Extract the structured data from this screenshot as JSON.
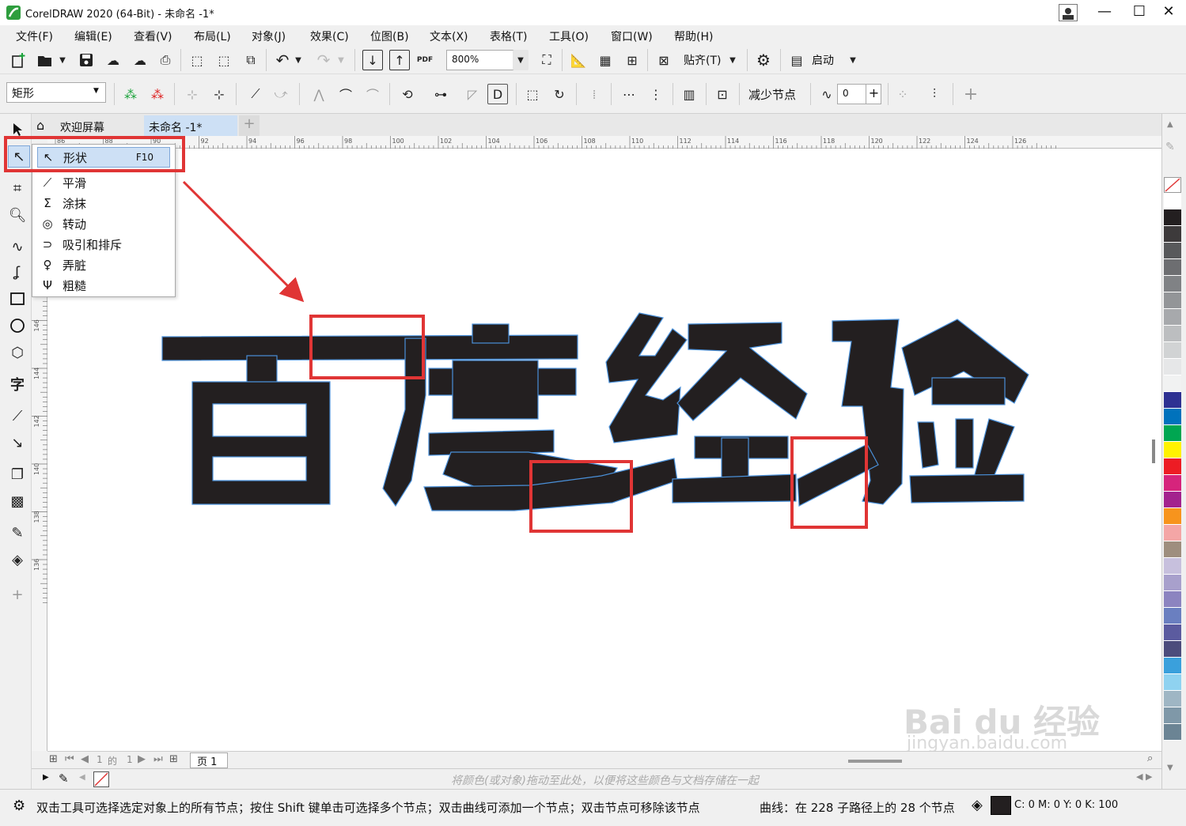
{
  "window": {
    "title": "CorelDRAW 2020 (64-Bit) - 未命名 -1*",
    "controls": {
      "minimize": "—",
      "maximize": "☐",
      "close": "✕"
    }
  },
  "menu": [
    "文件(F)",
    "编辑(E)",
    "查看(V)",
    "布局(L)",
    "对象(J)",
    "效果(C)",
    "位图(B)",
    "文本(X)",
    "表格(T)",
    "工具(O)",
    "窗口(W)",
    "帮助(H)"
  ],
  "toolbar": {
    "zoom": "800%",
    "snap_label": "贴齐(T)",
    "launch_label": "启动",
    "pdf_label": "PDF"
  },
  "propbar": {
    "shape_select": "矩形",
    "reduce_nodes": "减少节点",
    "smoothness_value": "0"
  },
  "tabs": {
    "welcome": "欢迎屏幕",
    "document": "未命名 -1*"
  },
  "ruler_h": [
    "86",
    "88",
    "90",
    "92",
    "94",
    "96",
    "98",
    "100",
    "102",
    "104",
    "106",
    "108",
    "110",
    "112",
    "114",
    "116",
    "118",
    "120",
    "122",
    "124",
    "126"
  ],
  "ruler_v": [
    "152",
    "150",
    "148",
    "146",
    "144",
    "142",
    "140",
    "138",
    "136"
  ],
  "flyout": {
    "items": [
      {
        "label": "形状",
        "shortcut": "F10",
        "icon": "shape-tool-icon"
      },
      {
        "label": "平滑",
        "icon": "smooth-icon"
      },
      {
        "label": "涂抹",
        "icon": "smear-icon"
      },
      {
        "label": "转动",
        "icon": "twirl-icon"
      },
      {
        "label": "吸引和排斥",
        "icon": "attract-repel-icon"
      },
      {
        "label": "弄脏",
        "icon": "smudge-icon"
      },
      {
        "label": "粗糙",
        "icon": "roughen-icon"
      }
    ]
  },
  "canvas_text": "百度经验",
  "pagebar": {
    "current": "1",
    "of": "的",
    "total": "1",
    "page_tab": "页 1"
  },
  "colorbar_hint": "将颜色(或对象)拖动至此处，以便将这些颜色与文档存储在一起",
  "status": {
    "hint": "双击工具可选择选定对象上的所有节点；按住 Shift 键单击可选择多个节点；双击曲线可添加一个节点；双击节点可移除该节点",
    "curve_info": "曲线：在 228 子路径上的 28 个节点",
    "cmyk": "C: 0 M: 0 Y: 0 K: 100"
  },
  "watermark": {
    "brand": "Bai du 经验",
    "url": "jingyan.baidu.com"
  },
  "palette": [
    "#ffffff",
    "#231f20",
    "#3d3a3b",
    "#58595b",
    "#6d6e71",
    "#808285",
    "#939598",
    "#a7a9ac",
    "#bcbec0",
    "#d1d3d4",
    "#e6e7e8",
    "#f1f2f2",
    "#2e3192",
    "#0072bc",
    "#00a651",
    "#fff200",
    "#ed1c24",
    "#d6247c",
    "#a3238e",
    "#f7941d",
    "#f4a6a6",
    "#9e8e7e",
    "#c7c0dd",
    "#a8a0cc",
    "#8c84c0",
    "#6a7fc0",
    "#5b5b9f",
    "#4c4c7c",
    "#3aa0dc",
    "#8fd2f0",
    "#9fb6c4",
    "#7f98a8",
    "#6b8494"
  ]
}
